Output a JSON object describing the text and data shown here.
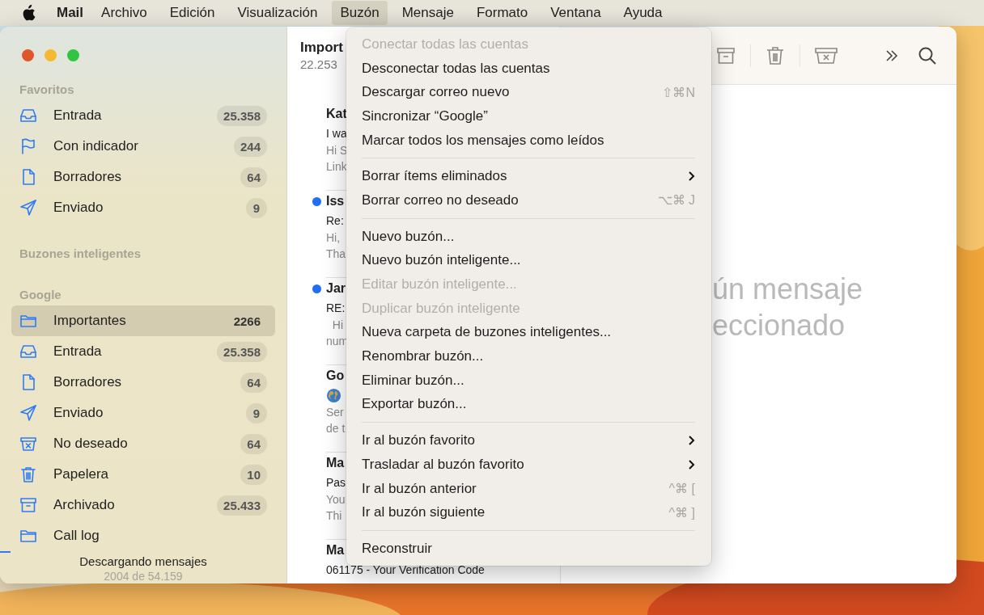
{
  "menubar": {
    "app": "Mail",
    "items": [
      {
        "label": "Archivo",
        "selected": false
      },
      {
        "label": "Edición",
        "selected": false
      },
      {
        "label": "Visualización",
        "selected": false
      },
      {
        "label": "Buzón",
        "selected": true
      },
      {
        "label": "Mensaje",
        "selected": false
      },
      {
        "label": "Formato",
        "selected": false
      },
      {
        "label": "Ventana",
        "selected": false
      },
      {
        "label": "Ayuda",
        "selected": false
      }
    ]
  },
  "sidebar": {
    "sections": [
      {
        "title": "Favoritos",
        "items": [
          {
            "kind": "inbox",
            "label": "Entrada",
            "count": "25.358",
            "selected": false
          },
          {
            "kind": "flag",
            "label": "Con indicador",
            "count": "244",
            "selected": false
          },
          {
            "kind": "draft",
            "label": "Borradores",
            "count": "64",
            "selected": false
          },
          {
            "kind": "sent",
            "label": "Enviado",
            "count": "9",
            "selected": false
          }
        ]
      },
      {
        "title": "Buzones inteligentes"
      },
      {
        "title": "Google",
        "items": [
          {
            "kind": "folder",
            "label": "Importantes",
            "count": "2266",
            "selected": true
          },
          {
            "kind": "inbox",
            "label": "Entrada",
            "count": "25.358",
            "selected": false
          },
          {
            "kind": "draft",
            "label": "Borradores",
            "count": "64",
            "selected": false
          },
          {
            "kind": "sent",
            "label": "Enviado",
            "count": "9",
            "selected": false
          },
          {
            "kind": "junk",
            "label": "No deseado",
            "count": "64",
            "selected": false
          },
          {
            "kind": "trash",
            "label": "Papelera",
            "count": "10",
            "selected": false
          },
          {
            "kind": "archive",
            "label": "Archivado",
            "count": "25.433",
            "selected": false
          },
          {
            "kind": "folder",
            "label": "Call log",
            "selected": false
          }
        ]
      }
    ],
    "status": {
      "title": "Descargando mensajes",
      "detail": "2004 de 54.159",
      "level": 0.037
    }
  },
  "message_list": {
    "title": "Import",
    "count": "22.253",
    "messages": [
      {
        "unread": false,
        "sender": "Kat",
        "subject": "I wa",
        "preview": [
          "Hi S",
          "Link"
        ]
      },
      {
        "unread": true,
        "sender": "Iss",
        "subject": "Re:",
        "preview": [
          "Hi,",
          "Tha"
        ]
      },
      {
        "unread": true,
        "sender": "Jar",
        "subject": "RE:",
        "preview": [
          "  Hi",
          "num"
        ]
      },
      {
        "unread": false,
        "sender": "Go",
        "subject_icon": true,
        "preview": [
          "Ser",
          "de t"
        ]
      },
      {
        "unread": false,
        "sender": "Ma",
        "subject": "Pas",
        "preview": [
          "You",
          "Thi"
        ]
      },
      {
        "unread": false,
        "sender": "Ma",
        "subject": "061175 - Your Verification Code"
      }
    ]
  },
  "detail": {
    "placeholder": [
      "ún mensaje",
      "eccionado"
    ]
  },
  "menu": [
    {
      "kind": "item",
      "label": "Conectar todas las cuentas",
      "disabled": true
    },
    {
      "kind": "item",
      "label": "Desconectar todas las cuentas",
      "disabled": false
    },
    {
      "kind": "item",
      "label": "Descargar correo nuevo",
      "shortcut": "⇧⌘N",
      "disabled": false
    },
    {
      "kind": "item",
      "label": "Sincronizar “Google”",
      "disabled": false
    },
    {
      "kind": "item",
      "label": "Marcar todos los mensajes como leídos",
      "disabled": false
    },
    {
      "kind": "separator"
    },
    {
      "kind": "item",
      "label": "Borrar ítems eliminados",
      "submenu": true,
      "disabled": false
    },
    {
      "kind": "item",
      "label": "Borrar correo no deseado",
      "shortcut": "⌥⌘ J",
      "disabled": false
    },
    {
      "kind": "separator"
    },
    {
      "kind": "item",
      "label": "Nuevo buzón...",
      "disabled": false
    },
    {
      "kind": "item",
      "label": "Nuevo buzón inteligente...",
      "disabled": false
    },
    {
      "kind": "item",
      "label": "Editar buzón inteligente...",
      "disabled": true
    },
    {
      "kind": "item",
      "label": "Duplicar buzón inteligente",
      "disabled": true
    },
    {
      "kind": "item",
      "label": "Nueva carpeta de buzones inteligentes...",
      "disabled": false
    },
    {
      "kind": "item",
      "label": "Renombrar buzón...",
      "disabled": false
    },
    {
      "kind": "item",
      "label": "Eliminar buzón...",
      "disabled": false
    },
    {
      "kind": "item",
      "label": "Exportar buzón...",
      "disabled": false
    },
    {
      "kind": "separator"
    },
    {
      "kind": "item",
      "label": "Ir al buzón favorito",
      "submenu": true,
      "disabled": false
    },
    {
      "kind": "item",
      "label": "Trasladar al buzón favorito",
      "submenu": true,
      "disabled": false
    },
    {
      "kind": "item",
      "label": "Ir al buzón anterior",
      "shortcut": "^⌘ [",
      "disabled": false
    },
    {
      "kind": "item",
      "label": "Ir al buzón siguiente",
      "shortcut": "^⌘ ]",
      "disabled": false
    },
    {
      "kind": "separator"
    },
    {
      "kind": "item",
      "label": "Reconstruir",
      "disabled": false
    }
  ]
}
